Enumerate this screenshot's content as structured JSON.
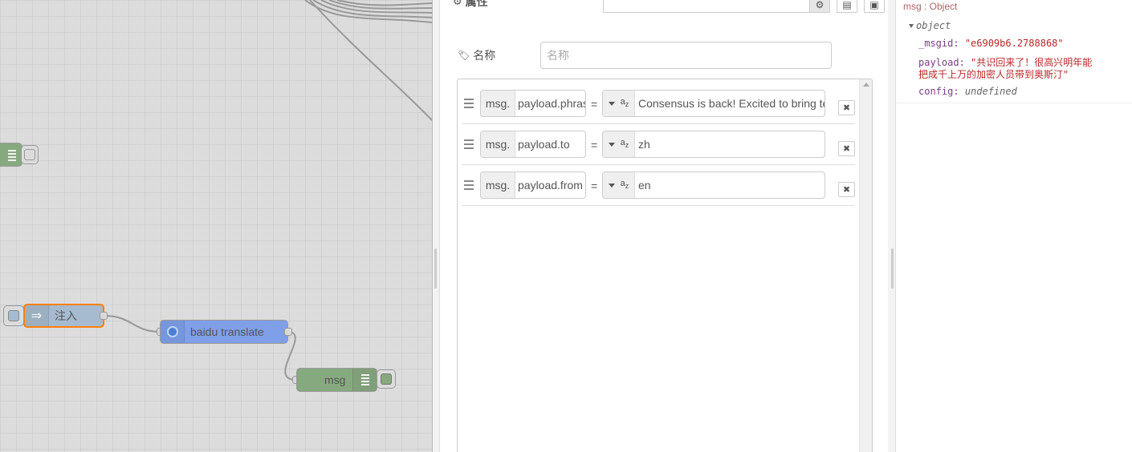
{
  "workspace": {
    "nodes": {
      "inject": {
        "label": "注入"
      },
      "translate": {
        "label": "baidu translate"
      },
      "debug": {
        "label": "msg"
      }
    }
  },
  "tray": {
    "properties_label": "属性",
    "name_label": "名称",
    "name_placeholder": "名称",
    "rules": [
      {
        "prefix": "msg.",
        "property": "payload.phrase",
        "operator": "=",
        "type": "az",
        "value": "Consensus is back! Excited to bring te"
      },
      {
        "prefix": "msg.",
        "property": "payload.to",
        "operator": "=",
        "type": "az",
        "value": "zh"
      },
      {
        "prefix": "msg.",
        "property": "payload.from",
        "operator": "=",
        "type": "az",
        "value": "en"
      }
    ]
  },
  "sidebar": {
    "debug_message": {
      "topic": "msg : Object",
      "object_label": "object",
      "fields": [
        {
          "key": "_msgid:",
          "value": "\"e6909b6.2788868\""
        },
        {
          "key": "payload:",
          "value": "\"共识回来了！很高兴明年能",
          "value_cont": "把成千上万的加密人员带到奥斯汀\""
        },
        {
          "key": "config:",
          "value": "undefined"
        }
      ]
    }
  },
  "colors": {
    "inject_node": "#a6bbcf",
    "translate_node": "#7f9fe8",
    "debug_node": "#87a980",
    "selected_border": "#ff7f0e"
  }
}
